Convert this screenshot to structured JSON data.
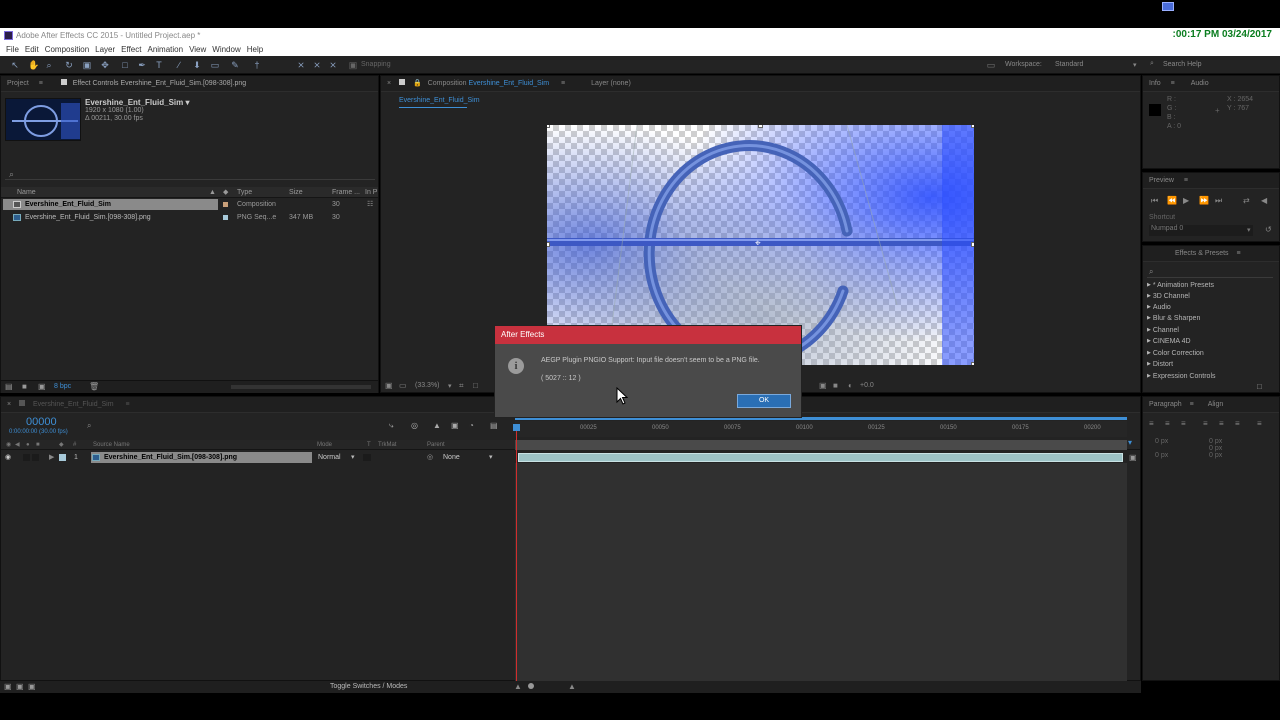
{
  "os": {
    "clock": ":00:17 PM 03/24/2017"
  },
  "app": {
    "title": "Adobe After Effects CC 2015 - Untitled Project.aep *"
  },
  "menu": [
    "File",
    "Edit",
    "Composition",
    "Layer",
    "Effect",
    "Animation",
    "View",
    "Window",
    "Help"
  ],
  "toolbar": {
    "snapping": "Snapping",
    "workspace_label": "Workspace:",
    "workspace_value": "Standard",
    "search_placeholder": "Search Help"
  },
  "project_panel": {
    "tab_project": "Project",
    "tab_effect_controls": "Effect Controls Evershine_Ent_Fluid_Sim.[098-308].png",
    "thumb_name": "Evershine_Ent_Fluid_Sim ▾",
    "thumb_res": "1920 x 1080 (1.00)",
    "thumb_dur": "Δ 00211, 30.00 fps",
    "columns": {
      "name": "Name",
      "type": "Type",
      "size": "Size",
      "frame": "Frame ...",
      "inpoint": "In P"
    },
    "items": [
      {
        "name": "Evershine_Ent_Fluid_Sim",
        "type": "Composition",
        "size": "",
        "frame": "30"
      },
      {
        "name": "Evershine_Ent_Fluid_Sim.[098-308].png",
        "type": "PNG Seq...e",
        "size": "347 MB",
        "frame": "30"
      }
    ],
    "bpc": "8 bpc"
  },
  "comp_panel": {
    "tab": "Composition",
    "tab_name": "Evershine_Ent_Fluid_Sim",
    "layer_tab": "Layer (none)",
    "breadcrumb": "Evershine_Ent_Fluid_Sim",
    "zoom": "(33.3%)",
    "exposure": "+0.0"
  },
  "info_panel": {
    "tab_info": "Info",
    "tab_audio": "Audio",
    "r": "R :",
    "g": "G :",
    "b": "B :",
    "a": "A : 0",
    "x": "X : 2654",
    "y": "Y : 767"
  },
  "preview_panel": {
    "tab": "Preview",
    "shortcut_label": "Shortcut",
    "shortcut_value": "Numpad 0"
  },
  "effects_panel": {
    "tab": "Effects & Presets",
    "items": [
      "* Animation Presets",
      "3D Channel",
      "Audio",
      "Blur & Sharpen",
      "Channel",
      "CINEMA 4D",
      "Color Correction",
      "Distort",
      "Expression Controls"
    ]
  },
  "paragraph_panel": {
    "tab_paragraph": "Paragraph",
    "tab_align": "Align",
    "px1": "0 px",
    "px2": "0 px",
    "px3": "0 px",
    "px4": "0 px",
    "px5": "0 px"
  },
  "timeline": {
    "tab": "Evershine_Ent_Fluid_Sim",
    "timecode": "00000",
    "timecode_sub": "0:00:00:00 (30.00 fps)",
    "columns": {
      "source": "Source Name",
      "mode": "Mode",
      "t": "T",
      "trkmat": "TrkMat",
      "parent": "Parent"
    },
    "layer": {
      "num": "1",
      "name": "Evershine_Ent_Fluid_Sim.[098-308].png",
      "mode": "Normal",
      "parent": "None"
    },
    "ruler": [
      "00025",
      "00050",
      "00075",
      "00100",
      "00125",
      "00150",
      "00175",
      "00200"
    ],
    "toggle_label": "Toggle Switches / Modes"
  },
  "dialog": {
    "title": "After Effects",
    "message": "AEGP Plugin PNGIO Support: Input file doesn't seem to be a PNG file.",
    "code": "( 5027 :: 12 )",
    "ok_label": "OK"
  },
  "colors": {
    "accent": "#3e8fd6",
    "dialog_title": "#c8313e",
    "ok_button": "#2a6fb5"
  }
}
